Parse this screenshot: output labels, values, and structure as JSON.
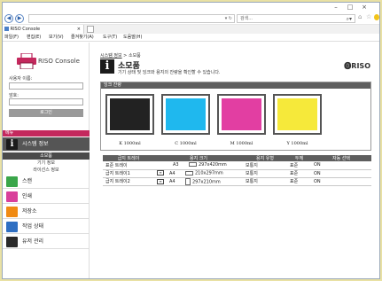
{
  "browser": {
    "address_dropdown": "▾ ↻",
    "search_placeholder": "검색...",
    "tab_title": "RISO Console",
    "tab_close": "×",
    "menu": [
      "파일(F)",
      "편집(E)",
      "보기(V)",
      "즐겨찾기(A)",
      "도구(T)",
      "도움말(H)"
    ]
  },
  "sidebar": {
    "brand": "RISO Console",
    "username_label": "사용자 이름:",
    "password_label": "암호:",
    "login_button": "로그인",
    "nav_header": "메뉴",
    "nav": [
      {
        "label": "시스템 정보",
        "icon": "info-icon",
        "color": "#1b1b1b"
      },
      {
        "label": "스캔",
        "icon": "scan-icon",
        "color": "#3aa64a"
      },
      {
        "label": "인쇄",
        "icon": "print-icon",
        "color": "#d9409b"
      },
      {
        "label": "저장소",
        "icon": "storage-icon",
        "color": "#f08a12"
      },
      {
        "label": "작업 상태",
        "icon": "job-status-icon",
        "color": "#2f6fc2"
      },
      {
        "label": "유저 관리",
        "icon": "user-management-icon",
        "color": "#2a2a2a"
      }
    ],
    "subnav": [
      "소모품",
      "기기 정보",
      "라이선스 정보"
    ]
  },
  "main": {
    "breadcrumb_link": "시스템 정보",
    "breadcrumb_sep": " > ",
    "breadcrumb_current": "소모품",
    "title": "소모품",
    "description": "기기 상태 및 잉크와 용지의 잔량을 확인할 수 있습니다.",
    "riso_logo": "⓿RISO",
    "ink_panel_title": "잉크 잔량",
    "inks": [
      {
        "label": "K 1000ml",
        "color": "#222222"
      },
      {
        "label": "C 1000ml",
        "color": "#1fb8ee"
      },
      {
        "label": "M 1000ml",
        "color": "#e23ea2"
      },
      {
        "label": "Y 1000ml",
        "color": "#f6e93a"
      }
    ],
    "tray_columns": [
      "급지 트레이",
      "용지 크기",
      "용지 유형",
      "두께",
      "자동 선택"
    ],
    "trays": [
      {
        "tray": "표준 트레이",
        "size_code": "A3",
        "size_mm": "297x420mm",
        "type": "보통지",
        "thickness": "표준",
        "auto": "ON",
        "has_icon": false,
        "orientation": "landscape"
      },
      {
        "tray": "급지 트레이1",
        "size_code": "A4",
        "size_mm": "210x297mm",
        "type": "보통지",
        "thickness": "표준",
        "auto": "ON",
        "has_icon": true,
        "orientation": "landscape"
      },
      {
        "tray": "급지 트레이2",
        "size_code": "A4",
        "size_mm": "297x210mm",
        "type": "보통지",
        "thickness": "표준",
        "auto": "ON",
        "has_icon": true,
        "orientation": "portrait"
      }
    ]
  }
}
